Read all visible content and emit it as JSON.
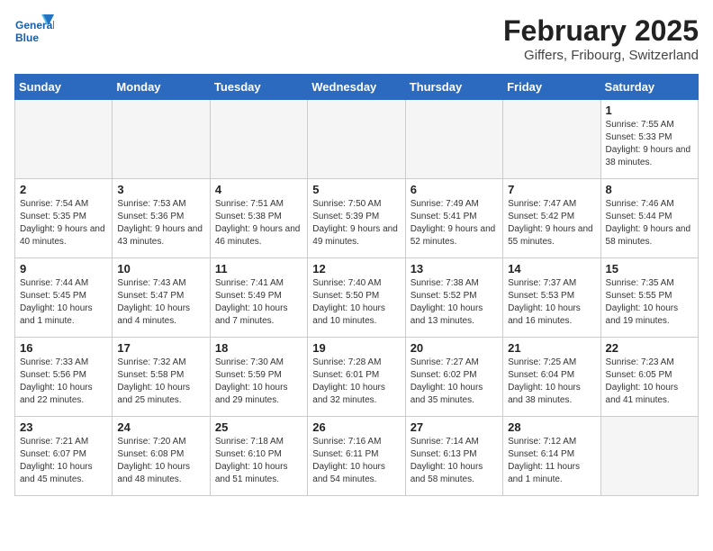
{
  "header": {
    "logo_general": "General",
    "logo_blue": "Blue",
    "month_year": "February 2025",
    "location": "Giffers, Fribourg, Switzerland"
  },
  "weekdays": [
    "Sunday",
    "Monday",
    "Tuesday",
    "Wednesday",
    "Thursday",
    "Friday",
    "Saturday"
  ],
  "weeks": [
    [
      {
        "day": "",
        "info": ""
      },
      {
        "day": "",
        "info": ""
      },
      {
        "day": "",
        "info": ""
      },
      {
        "day": "",
        "info": ""
      },
      {
        "day": "",
        "info": ""
      },
      {
        "day": "",
        "info": ""
      },
      {
        "day": "1",
        "info": "Sunrise: 7:55 AM\nSunset: 5:33 PM\nDaylight: 9 hours and 38 minutes."
      }
    ],
    [
      {
        "day": "2",
        "info": "Sunrise: 7:54 AM\nSunset: 5:35 PM\nDaylight: 9 hours and 40 minutes."
      },
      {
        "day": "3",
        "info": "Sunrise: 7:53 AM\nSunset: 5:36 PM\nDaylight: 9 hours and 43 minutes."
      },
      {
        "day": "4",
        "info": "Sunrise: 7:51 AM\nSunset: 5:38 PM\nDaylight: 9 hours and 46 minutes."
      },
      {
        "day": "5",
        "info": "Sunrise: 7:50 AM\nSunset: 5:39 PM\nDaylight: 9 hours and 49 minutes."
      },
      {
        "day": "6",
        "info": "Sunrise: 7:49 AM\nSunset: 5:41 PM\nDaylight: 9 hours and 52 minutes."
      },
      {
        "day": "7",
        "info": "Sunrise: 7:47 AM\nSunset: 5:42 PM\nDaylight: 9 hours and 55 minutes."
      },
      {
        "day": "8",
        "info": "Sunrise: 7:46 AM\nSunset: 5:44 PM\nDaylight: 9 hours and 58 minutes."
      }
    ],
    [
      {
        "day": "9",
        "info": "Sunrise: 7:44 AM\nSunset: 5:45 PM\nDaylight: 10 hours and 1 minute."
      },
      {
        "day": "10",
        "info": "Sunrise: 7:43 AM\nSunset: 5:47 PM\nDaylight: 10 hours and 4 minutes."
      },
      {
        "day": "11",
        "info": "Sunrise: 7:41 AM\nSunset: 5:49 PM\nDaylight: 10 hours and 7 minutes."
      },
      {
        "day": "12",
        "info": "Sunrise: 7:40 AM\nSunset: 5:50 PM\nDaylight: 10 hours and 10 minutes."
      },
      {
        "day": "13",
        "info": "Sunrise: 7:38 AM\nSunset: 5:52 PM\nDaylight: 10 hours and 13 minutes."
      },
      {
        "day": "14",
        "info": "Sunrise: 7:37 AM\nSunset: 5:53 PM\nDaylight: 10 hours and 16 minutes."
      },
      {
        "day": "15",
        "info": "Sunrise: 7:35 AM\nSunset: 5:55 PM\nDaylight: 10 hours and 19 minutes."
      }
    ],
    [
      {
        "day": "16",
        "info": "Sunrise: 7:33 AM\nSunset: 5:56 PM\nDaylight: 10 hours and 22 minutes."
      },
      {
        "day": "17",
        "info": "Sunrise: 7:32 AM\nSunset: 5:58 PM\nDaylight: 10 hours and 25 minutes."
      },
      {
        "day": "18",
        "info": "Sunrise: 7:30 AM\nSunset: 5:59 PM\nDaylight: 10 hours and 29 minutes."
      },
      {
        "day": "19",
        "info": "Sunrise: 7:28 AM\nSunset: 6:01 PM\nDaylight: 10 hours and 32 minutes."
      },
      {
        "day": "20",
        "info": "Sunrise: 7:27 AM\nSunset: 6:02 PM\nDaylight: 10 hours and 35 minutes."
      },
      {
        "day": "21",
        "info": "Sunrise: 7:25 AM\nSunset: 6:04 PM\nDaylight: 10 hours and 38 minutes."
      },
      {
        "day": "22",
        "info": "Sunrise: 7:23 AM\nSunset: 6:05 PM\nDaylight: 10 hours and 41 minutes."
      }
    ],
    [
      {
        "day": "23",
        "info": "Sunrise: 7:21 AM\nSunset: 6:07 PM\nDaylight: 10 hours and 45 minutes."
      },
      {
        "day": "24",
        "info": "Sunrise: 7:20 AM\nSunset: 6:08 PM\nDaylight: 10 hours and 48 minutes."
      },
      {
        "day": "25",
        "info": "Sunrise: 7:18 AM\nSunset: 6:10 PM\nDaylight: 10 hours and 51 minutes."
      },
      {
        "day": "26",
        "info": "Sunrise: 7:16 AM\nSunset: 6:11 PM\nDaylight: 10 hours and 54 minutes."
      },
      {
        "day": "27",
        "info": "Sunrise: 7:14 AM\nSunset: 6:13 PM\nDaylight: 10 hours and 58 minutes."
      },
      {
        "day": "28",
        "info": "Sunrise: 7:12 AM\nSunset: 6:14 PM\nDaylight: 11 hours and 1 minute."
      },
      {
        "day": "",
        "info": ""
      }
    ]
  ]
}
